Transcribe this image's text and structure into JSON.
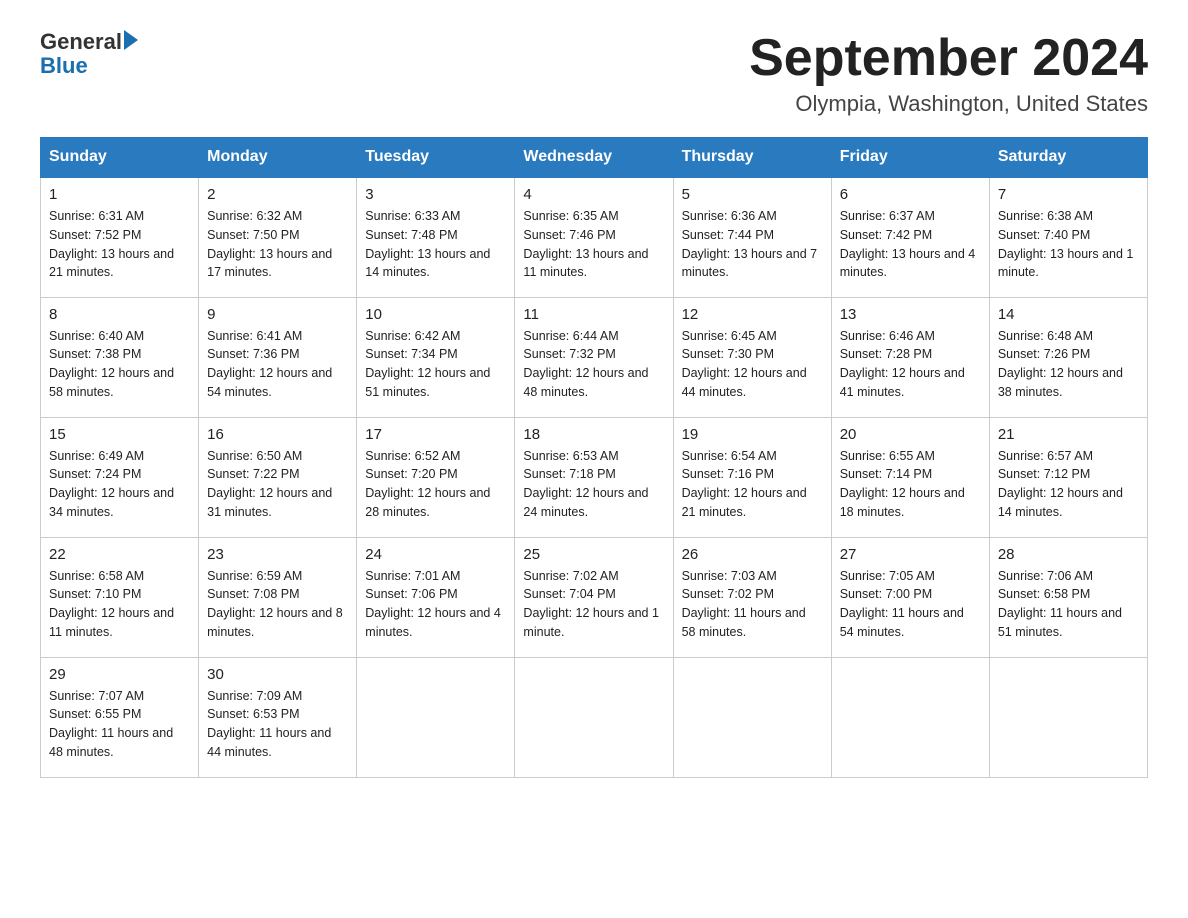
{
  "logo": {
    "general": "General",
    "blue": "Blue"
  },
  "header": {
    "month": "September 2024",
    "location": "Olympia, Washington, United States"
  },
  "days_of_week": [
    "Sunday",
    "Monday",
    "Tuesday",
    "Wednesday",
    "Thursday",
    "Friday",
    "Saturday"
  ],
  "weeks": [
    [
      {
        "day": "1",
        "sunrise": "6:31 AM",
        "sunset": "7:52 PM",
        "daylight": "13 hours and 21 minutes."
      },
      {
        "day": "2",
        "sunrise": "6:32 AM",
        "sunset": "7:50 PM",
        "daylight": "13 hours and 17 minutes."
      },
      {
        "day": "3",
        "sunrise": "6:33 AM",
        "sunset": "7:48 PM",
        "daylight": "13 hours and 14 minutes."
      },
      {
        "day": "4",
        "sunrise": "6:35 AM",
        "sunset": "7:46 PM",
        "daylight": "13 hours and 11 minutes."
      },
      {
        "day": "5",
        "sunrise": "6:36 AM",
        "sunset": "7:44 PM",
        "daylight": "13 hours and 7 minutes."
      },
      {
        "day": "6",
        "sunrise": "6:37 AM",
        "sunset": "7:42 PM",
        "daylight": "13 hours and 4 minutes."
      },
      {
        "day": "7",
        "sunrise": "6:38 AM",
        "sunset": "7:40 PM",
        "daylight": "13 hours and 1 minute."
      }
    ],
    [
      {
        "day": "8",
        "sunrise": "6:40 AM",
        "sunset": "7:38 PM",
        "daylight": "12 hours and 58 minutes."
      },
      {
        "day": "9",
        "sunrise": "6:41 AM",
        "sunset": "7:36 PM",
        "daylight": "12 hours and 54 minutes."
      },
      {
        "day": "10",
        "sunrise": "6:42 AM",
        "sunset": "7:34 PM",
        "daylight": "12 hours and 51 minutes."
      },
      {
        "day": "11",
        "sunrise": "6:44 AM",
        "sunset": "7:32 PM",
        "daylight": "12 hours and 48 minutes."
      },
      {
        "day": "12",
        "sunrise": "6:45 AM",
        "sunset": "7:30 PM",
        "daylight": "12 hours and 44 minutes."
      },
      {
        "day": "13",
        "sunrise": "6:46 AM",
        "sunset": "7:28 PM",
        "daylight": "12 hours and 41 minutes."
      },
      {
        "day": "14",
        "sunrise": "6:48 AM",
        "sunset": "7:26 PM",
        "daylight": "12 hours and 38 minutes."
      }
    ],
    [
      {
        "day": "15",
        "sunrise": "6:49 AM",
        "sunset": "7:24 PM",
        "daylight": "12 hours and 34 minutes."
      },
      {
        "day": "16",
        "sunrise": "6:50 AM",
        "sunset": "7:22 PM",
        "daylight": "12 hours and 31 minutes."
      },
      {
        "day": "17",
        "sunrise": "6:52 AM",
        "sunset": "7:20 PM",
        "daylight": "12 hours and 28 minutes."
      },
      {
        "day": "18",
        "sunrise": "6:53 AM",
        "sunset": "7:18 PM",
        "daylight": "12 hours and 24 minutes."
      },
      {
        "day": "19",
        "sunrise": "6:54 AM",
        "sunset": "7:16 PM",
        "daylight": "12 hours and 21 minutes."
      },
      {
        "day": "20",
        "sunrise": "6:55 AM",
        "sunset": "7:14 PM",
        "daylight": "12 hours and 18 minutes."
      },
      {
        "day": "21",
        "sunrise": "6:57 AM",
        "sunset": "7:12 PM",
        "daylight": "12 hours and 14 minutes."
      }
    ],
    [
      {
        "day": "22",
        "sunrise": "6:58 AM",
        "sunset": "7:10 PM",
        "daylight": "12 hours and 11 minutes."
      },
      {
        "day": "23",
        "sunrise": "6:59 AM",
        "sunset": "7:08 PM",
        "daylight": "12 hours and 8 minutes."
      },
      {
        "day": "24",
        "sunrise": "7:01 AM",
        "sunset": "7:06 PM",
        "daylight": "12 hours and 4 minutes."
      },
      {
        "day": "25",
        "sunrise": "7:02 AM",
        "sunset": "7:04 PM",
        "daylight": "12 hours and 1 minute."
      },
      {
        "day": "26",
        "sunrise": "7:03 AM",
        "sunset": "7:02 PM",
        "daylight": "11 hours and 58 minutes."
      },
      {
        "day": "27",
        "sunrise": "7:05 AM",
        "sunset": "7:00 PM",
        "daylight": "11 hours and 54 minutes."
      },
      {
        "day": "28",
        "sunrise": "7:06 AM",
        "sunset": "6:58 PM",
        "daylight": "11 hours and 51 minutes."
      }
    ],
    [
      {
        "day": "29",
        "sunrise": "7:07 AM",
        "sunset": "6:55 PM",
        "daylight": "11 hours and 48 minutes."
      },
      {
        "day": "30",
        "sunrise": "7:09 AM",
        "sunset": "6:53 PM",
        "daylight": "11 hours and 44 minutes."
      },
      null,
      null,
      null,
      null,
      null
    ]
  ]
}
